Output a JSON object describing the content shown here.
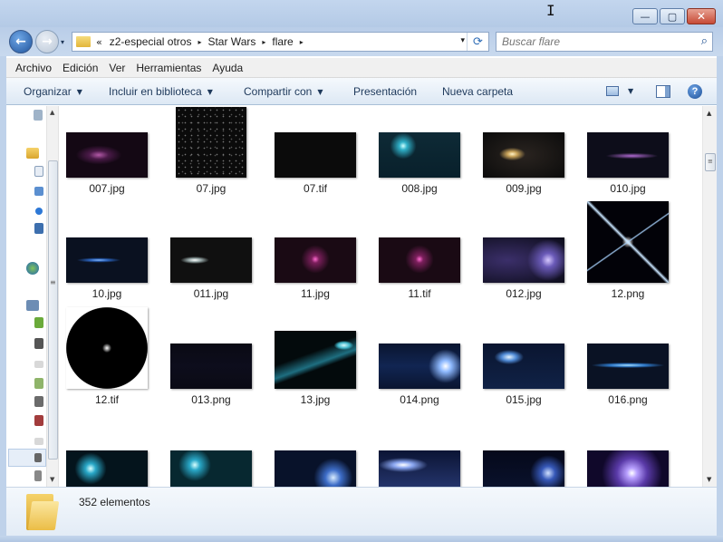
{
  "window": {
    "caption_buttons": [
      {
        "name": "minimize",
        "glyph": "—"
      },
      {
        "name": "maximize",
        "glyph": "▢"
      },
      {
        "name": "close",
        "glyph": "✕"
      }
    ]
  },
  "nav": {
    "back_glyph": "←",
    "forward_glyph": "→",
    "recent_glyph": "▾"
  },
  "address": {
    "prefix": "«",
    "crumbs": [
      "z2-especial otros",
      "Star Wars",
      "flare"
    ],
    "separator": "▸",
    "dropdown_glyph": "▾",
    "refresh_glyph": "⟳"
  },
  "search": {
    "placeholder": "Buscar flare",
    "icon_glyph": "⌕"
  },
  "menubar": [
    "Archivo",
    "Edición",
    "Ver",
    "Herramientas",
    "Ayuda"
  ],
  "commands": [
    {
      "label": "Organizar",
      "dropdown": true
    },
    {
      "label": "Incluir en biblioteca",
      "dropdown": true
    },
    {
      "label": "Compartir con",
      "dropdown": true
    },
    {
      "label": "Presentación",
      "dropdown": false
    },
    {
      "label": "Nueva carpeta",
      "dropdown": false
    }
  ],
  "command_icons": {
    "views": "view-icon",
    "preview_pane": "preview-pane-icon",
    "help": "?"
  },
  "files": [
    {
      "name": "007.jpg",
      "art": "pink-glow"
    },
    {
      "name": "07.jpg",
      "art": "starfield"
    },
    {
      "name": "07.tif",
      "art": "dark"
    },
    {
      "name": "008.jpg",
      "art": "teal-flare"
    },
    {
      "name": "009.jpg",
      "art": "warm-glow"
    },
    {
      "name": "010.jpg",
      "art": "violet-streak"
    },
    {
      "name": "10.jpg",
      "art": "blue-streak"
    },
    {
      "name": "011.jpg",
      "art": "white-flare"
    },
    {
      "name": "11.jpg",
      "art": "magenta-dot"
    },
    {
      "name": "11.tif",
      "art": "magenta-dot"
    },
    {
      "name": "012.jpg",
      "art": "lilac-flare"
    },
    {
      "name": "12.png",
      "art": "star-cross"
    },
    {
      "name": "12.tif",
      "art": "star-circle"
    },
    {
      "name": "013.png",
      "art": "dark-band"
    },
    {
      "name": "13.jpg",
      "art": "comet"
    },
    {
      "name": "014.png",
      "art": "blue-bright"
    },
    {
      "name": "015.jpg",
      "art": "blue-glare"
    },
    {
      "name": "016.png",
      "art": "cyan-line"
    },
    {
      "name": "",
      "art": "cyan-spark"
    },
    {
      "name": "",
      "art": "teal-spark"
    },
    {
      "name": "",
      "art": "blue-ring"
    },
    {
      "name": "",
      "art": "bright-band"
    },
    {
      "name": "",
      "art": "blue-dots"
    },
    {
      "name": "",
      "art": "purple-burst"
    }
  ],
  "status": {
    "count_text": "352 elementos"
  }
}
